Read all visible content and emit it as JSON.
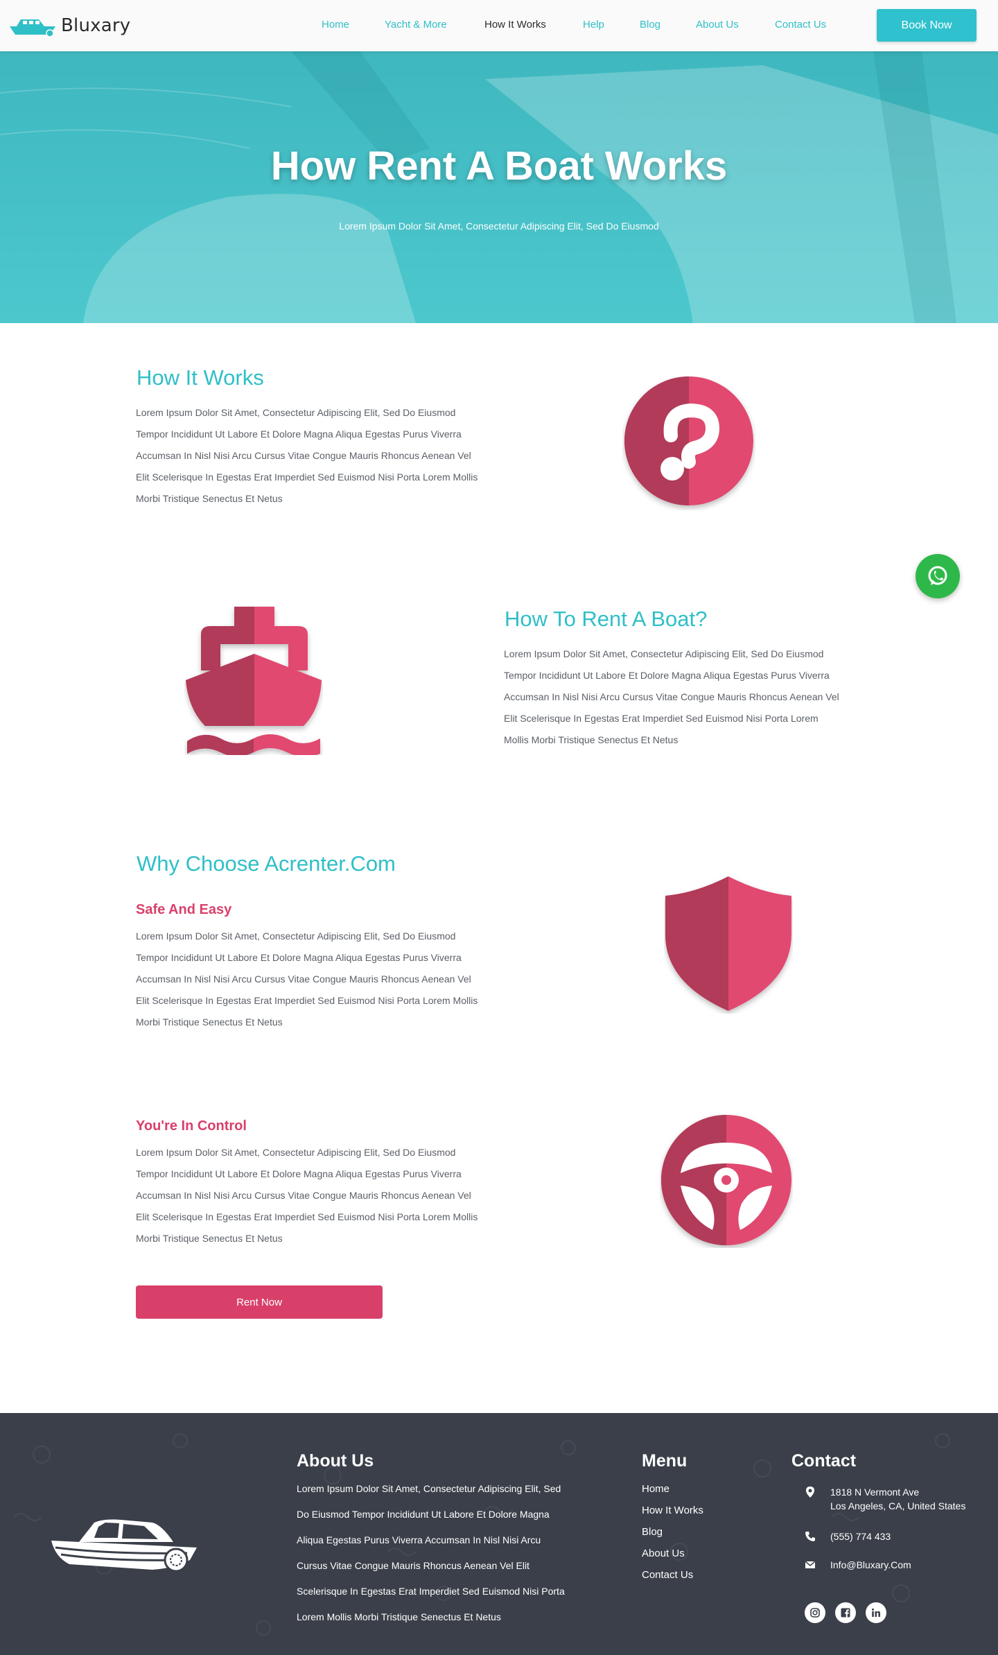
{
  "brand": {
    "name": "Bluxary"
  },
  "nav": {
    "items": [
      {
        "label": "Home",
        "active": false
      },
      {
        "label": "Yacht & More",
        "active": false
      },
      {
        "label": "How It Works",
        "active": true
      },
      {
        "label": "Help",
        "active": false
      },
      {
        "label": "Blog",
        "active": false
      },
      {
        "label": "About Us",
        "active": false
      },
      {
        "label": "Contact Us",
        "active": false
      }
    ],
    "cta": "Book Now"
  },
  "hero": {
    "title": "How Rent A Boat Works",
    "subtitle": "Lorem Ipsum Dolor Sit Amet, Consectetur Adipiscing Elit, Sed Do Eiusmod"
  },
  "sections": {
    "how_it_works": {
      "title": "How It Works",
      "lines": [
        "Lorem Ipsum Dolor Sit Amet, Consectetur Adipiscing Elit, Sed Do Eiusmod",
        "Tempor Incididunt Ut Labore Et Dolore Magna Aliqua Egestas Purus Viverra",
        "Accumsan In Nisl Nisi Arcu Cursus Vitae Congue Mauris Rhoncus Aenean Vel",
        "Elit Scelerisque In Egestas Erat Imperdiet Sed Euismod Nisi Porta Lorem Mollis",
        "Morbi Tristique Senectus Et Netus"
      ],
      "icon": "question-icon"
    },
    "how_to_rent": {
      "title": "How To Rent A Boat?",
      "lines": [
        "Lorem Ipsum Dolor Sit Amet, Consectetur Adipiscing Elit, Sed Do Eiusmod",
        "Tempor Incididunt Ut Labore Et Dolore Magna Aliqua Egestas Purus Viverra",
        "Accumsan In Nisl Nisi Arcu Cursus Vitae Congue Mauris Rhoncus Aenean Vel",
        "Elit Scelerisque In Egestas Erat Imperdiet Sed Euismod Nisi Porta Lorem",
        "Mollis Morbi Tristique Senectus Et Netus"
      ],
      "icon": "ship-icon"
    },
    "why_choose": {
      "title": "Why Choose Acrenter.Com",
      "safe": {
        "title": "Safe And Easy",
        "lines": [
          "Lorem Ipsum Dolor Sit Amet, Consectetur Adipiscing Elit, Sed Do Eiusmod",
          "Tempor Incididunt Ut Labore Et Dolore Magna Aliqua Egestas Purus Viverra",
          "Accumsan In Nisl Nisi Arcu Cursus Vitae Congue Mauris Rhoncus Aenean Vel",
          "Elit Scelerisque In Egestas Erat Imperdiet Sed Euismod Nisi Porta Lorem Mollis",
          "Morbi Tristique Senectus Et Netus"
        ],
        "icon": "shield-icon"
      },
      "control": {
        "title": "You're In Control",
        "lines": [
          "Lorem Ipsum Dolor Sit Amet, Consectetur Adipiscing Elit, Sed Do Eiusmod",
          "Tempor Incididunt Ut Labore Et Dolore Magna Aliqua Egestas Purus Viverra",
          "Accumsan In Nisl Nisi Arcu Cursus Vitae Congue Mauris Rhoncus Aenean Vel",
          "Elit Scelerisque In Egestas Erat Imperdiet Sed Euismod Nisi Porta Lorem Mollis",
          "Morbi Tristique Senectus Et Netus"
        ],
        "icon": "steering-wheel-icon"
      },
      "cta": "Rent Now"
    }
  },
  "footer": {
    "about": {
      "title": "About Us",
      "lines": [
        "Lorem Ipsum Dolor Sit Amet, Consectetur Adipiscing Elit, Sed",
        "Do Eiusmod Tempor Incididunt Ut Labore Et Dolore Magna",
        "Aliqua Egestas Purus Viverra Accumsan In Nisl Nisi Arcu",
        "Cursus Vitae Congue Mauris Rhoncus Aenean Vel Elit",
        "Scelerisque In Egestas Erat Imperdiet Sed Euismod Nisi Porta",
        "Lorem Mollis Morbi Tristique Senectus Et Netus"
      ]
    },
    "menu": {
      "title": "Menu",
      "items": [
        "Home",
        "How It Works",
        "Blog",
        "About Us",
        "Contact Us"
      ]
    },
    "contact": {
      "title": "Contact",
      "address_line1": "1818 N Vermont Ave",
      "address_line2": "Los Angeles, CA, United States",
      "phone": "(555) 774 433",
      "email": "Info@Bluxary.Com"
    },
    "social": [
      "instagram-icon",
      "facebook-icon",
      "linkedin-icon"
    ]
  },
  "colors": {
    "accent_teal": "#2fbfc7",
    "accent_pink": "#d8406a",
    "footer_bg": "#3a3f49",
    "whatsapp_green": "#2fb84a"
  }
}
